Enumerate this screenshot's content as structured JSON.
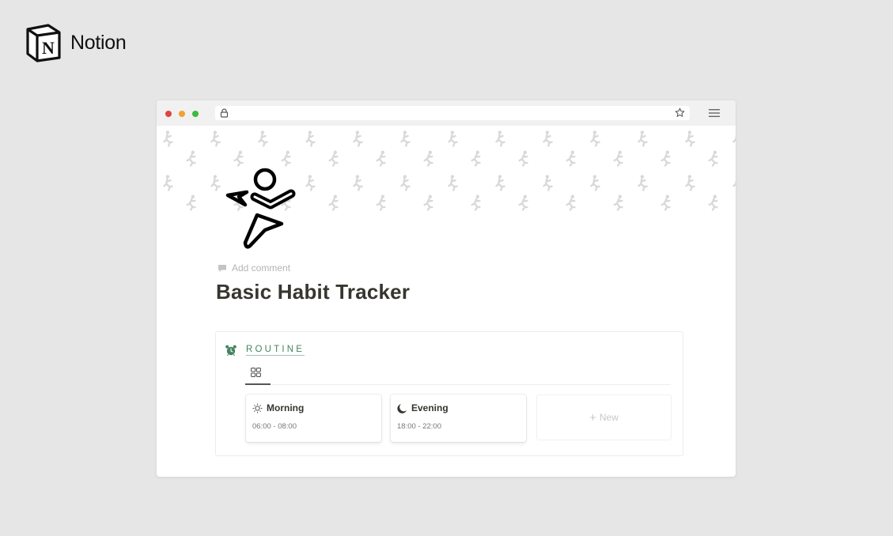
{
  "brand": {
    "name": "Notion",
    "logo_letter": "N"
  },
  "browser": {
    "traffic_lights": [
      "close",
      "minimize",
      "maximize"
    ],
    "address_bar": {
      "icon": "lock-icon",
      "value": ""
    },
    "bookmark_icon": "star-icon",
    "menu_icon": "hamburger-menu-icon"
  },
  "page": {
    "icon": "running-figure-icon",
    "add_comment_label": "Add comment",
    "title": "Basic Habit Tracker",
    "database": {
      "icon": "alarm-clock-icon",
      "title": "ROUTINE",
      "accent_color": "#448361",
      "views": [
        {
          "type": "gallery",
          "icon": "gallery-grid-icon",
          "active": true
        }
      ],
      "cards": [
        {
          "icon": "sun-icon",
          "title": "Morning",
          "time": "06:00 - 08:00"
        },
        {
          "icon": "moon-icon",
          "title": "Evening",
          "time": "18:00 - 22:00"
        }
      ],
      "new_label": "New"
    }
  }
}
